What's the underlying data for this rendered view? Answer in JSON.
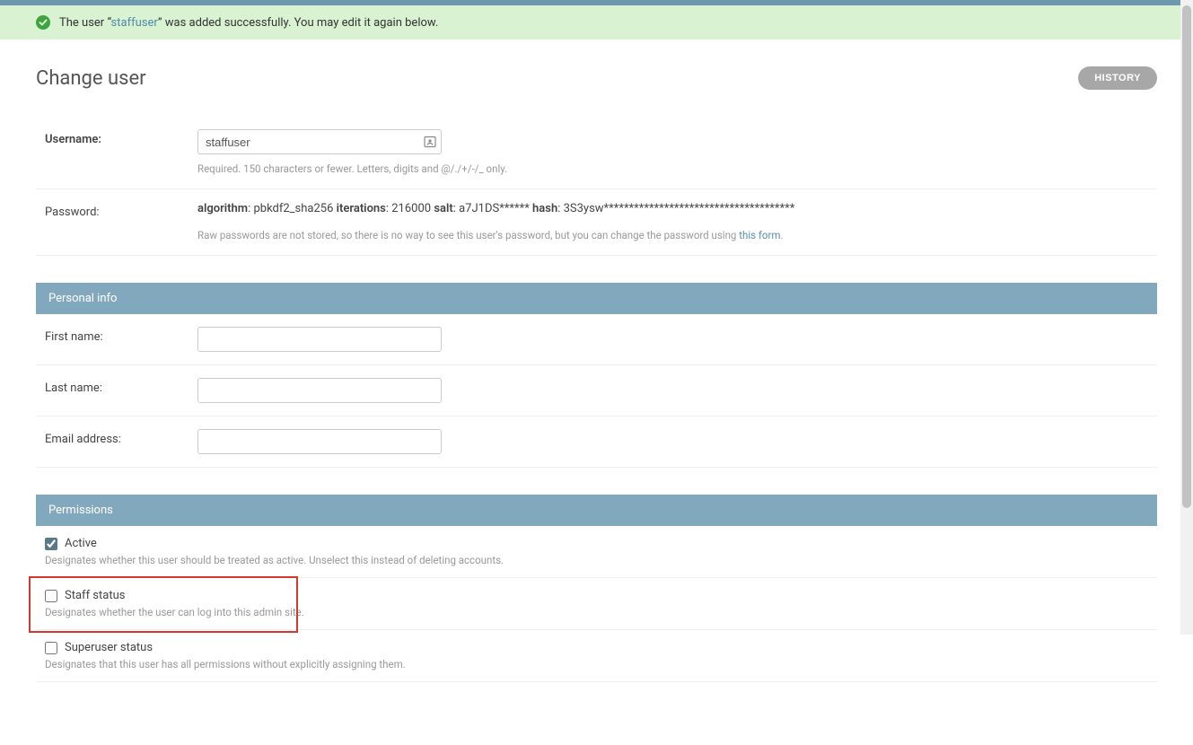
{
  "banner": {
    "prefix": "The user ",
    "quote_open": "“",
    "link_text": "staffuser",
    "quote_close": "”",
    "suffix": " was added successfully. You may edit it again below."
  },
  "page_title": "Change user",
  "history_label": "HISTORY",
  "username": {
    "label": "Username:",
    "value": "staffuser",
    "help": "Required. 150 characters or fewer. Letters, digits and @/./+/-/_ only."
  },
  "password": {
    "label": "Password:",
    "algorithm_label": "algorithm",
    "algorithm_value": ": pbkdf2_sha256 ",
    "iterations_label": "iterations",
    "iterations_value": ": 216000 ",
    "salt_label": "salt",
    "salt_value": ": a7J1DS****** ",
    "hash_label": "hash",
    "hash_value": ": 3S3ysw**************************************",
    "help_prefix": "Raw passwords are not stored, so there is no way to see this user's password, but you can change the password using ",
    "help_link": "this form",
    "help_suffix": "."
  },
  "sections": {
    "personal_info": "Personal info",
    "permissions": "Permissions"
  },
  "personal": {
    "first_name_label": "First name:",
    "last_name_label": "Last name:",
    "email_label": "Email address:"
  },
  "permissions": {
    "active": {
      "label": "Active",
      "help": "Designates whether this user should be treated as active. Unselect this instead of deleting accounts."
    },
    "staff": {
      "label": "Staff status",
      "help": "Designates whether the user can log into this admin site."
    },
    "superuser": {
      "label": "Superuser status",
      "help": "Designates that this user has all permissions without explicitly assigning them."
    }
  }
}
